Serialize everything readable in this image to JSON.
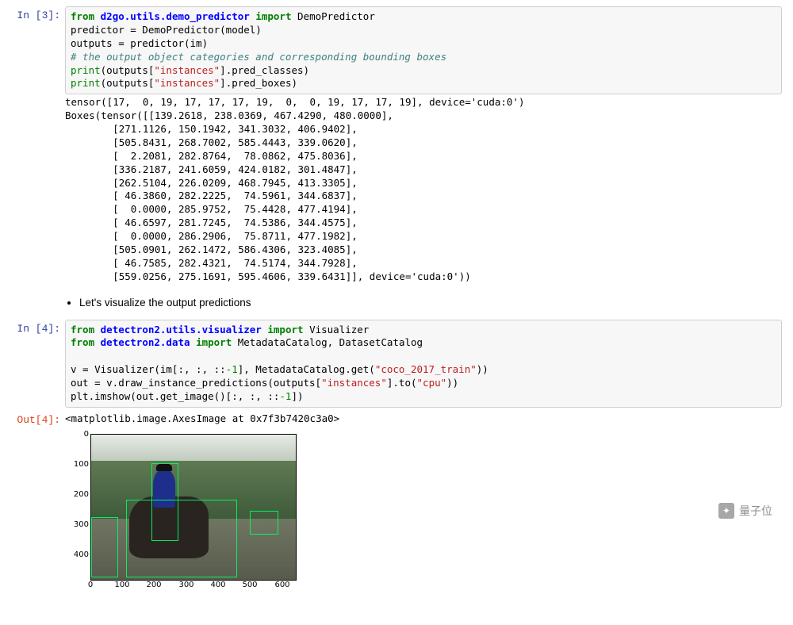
{
  "cells": {
    "c3": {
      "prompt": "In [3]:",
      "line1_from": "from",
      "line1_mod": "d2go.utils.demo_predictor",
      "line1_import": "import",
      "line1_name": "DemoPredictor",
      "line2": "predictor = DemoPredictor(model)",
      "line3": "outputs = predictor(im)",
      "line4_comment": "# the output object categories and corresponding bounding boxes",
      "line5_pre": "print",
      "line5_open": "(outputs[",
      "line5_str": "\"instances\"",
      "line5_rest": "].pred_classes)",
      "line6_pre": "print",
      "line6_open": "(outputs[",
      "line6_str": "\"instances\"",
      "line6_rest": "].pred_boxes)",
      "out_text": "tensor([17,  0, 19, 17, 17, 17, 19,  0,  0, 19, 17, 17, 19], device='cuda:0')\nBoxes(tensor([[139.2618, 238.0369, 467.4290, 480.0000],\n        [271.1126, 150.1942, 341.3032, 406.9402],\n        [505.8431, 268.7002, 585.4443, 339.0620],\n        [  2.2081, 282.8764,  78.0862, 475.8036],\n        [336.2187, 241.6059, 424.0182, 301.4847],\n        [262.5104, 226.0209, 468.7945, 413.3305],\n        [ 46.3860, 282.2225,  74.5961, 344.6837],\n        [  0.0000, 285.9752,  75.4428, 477.4194],\n        [ 46.6597, 281.7245,  74.5386, 344.4575],\n        [  0.0000, 286.2906,  75.8711, 477.1982],\n        [505.0901, 262.1472, 586.4306, 323.4085],\n        [ 46.7585, 282.4321,  74.5174, 344.7928],\n        [559.0256, 275.1691, 595.4606, 339.6431]], device='cuda:0'))"
    },
    "md": {
      "text": "Let's visualize the output predictions"
    },
    "c4": {
      "prompt": "In [4]:",
      "l1_from": "from",
      "l1_mod": "detectron2.utils.visualizer",
      "l1_import": "import",
      "l1_name": "Visualizer",
      "l2_from": "from",
      "l2_mod": "detectron2.data",
      "l2_import": "import",
      "l2_rest": "MetadataCatalog, DatasetCatalog",
      "l4_pre": "v = Visualizer(im[:, :, ::",
      "l4_neg1": "-1",
      "l4_mid": "], MetadataCatalog.get(",
      "l4_str": "\"coco_2017_train\"",
      "l4_end": "))",
      "l5_pre": "out = v.draw_instance_predictions(outputs[",
      "l5_str1": "\"instances\"",
      "l5_mid": "].to(",
      "l5_str2": "\"cpu\"",
      "l5_end": "))",
      "l6_pre": "plt.imshow(out.get_image()[:, :, ::",
      "l6_neg1": "-1",
      "l6_end": "])"
    },
    "out4": {
      "prompt": "Out[4]:",
      "text": "<matplotlib.image.AxesImage at 0x7f3b7420c3a0>"
    }
  },
  "chart_data": {
    "type": "image",
    "title": "",
    "xlabel": "",
    "ylabel": "",
    "x_ticks": [
      0,
      100,
      200,
      300,
      400,
      500,
      600
    ],
    "y_ticks": [
      0,
      100,
      200,
      300,
      400
    ],
    "xlim": [
      0,
      640
    ],
    "ylim": [
      480,
      0
    ],
    "description": "Detection visualization on a photo of a horse-mounted guard in blue uniform in front of trees; bounding boxes overlaid."
  },
  "watermark": "量子位"
}
